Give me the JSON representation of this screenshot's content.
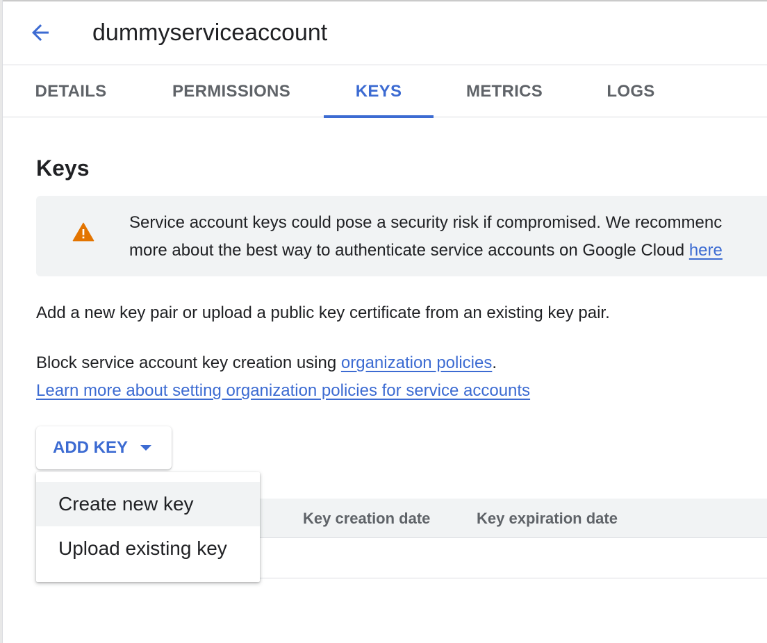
{
  "colors": {
    "accent": "#3c6bd2",
    "warning": "#e37400"
  },
  "header": {
    "back_icon": "arrow-left-icon",
    "title": "dummyserviceaccount"
  },
  "tabs": [
    {
      "label": "DETAILS"
    },
    {
      "label": "PERMISSIONS"
    },
    {
      "label": "KEYS",
      "active": true
    },
    {
      "label": "METRICS"
    },
    {
      "label": "LOGS"
    }
  ],
  "keys": {
    "title": "Keys",
    "warning": {
      "icon": "warning-icon",
      "line1": "Service account keys could pose a security risk if compromised. We recommenc",
      "line2": "more about the best way to authenticate service accounts on Google Cloud ",
      "link": "here"
    },
    "description": "Add a new key pair or upload a public key certificate from an existing key pair.",
    "block_prefix": "Block service account key creation using ",
    "block_link": "organization policies",
    "block_suffix": ".",
    "learn_more_link": "Learn more about setting organization policies for service accounts",
    "add_key_label": "ADD KEY",
    "table_headers": [
      "Key creation date",
      "Key expiration date"
    ]
  },
  "menu": {
    "items": [
      {
        "label": "Create new key",
        "highlighted": true
      },
      {
        "label": "Upload existing key"
      }
    ]
  }
}
